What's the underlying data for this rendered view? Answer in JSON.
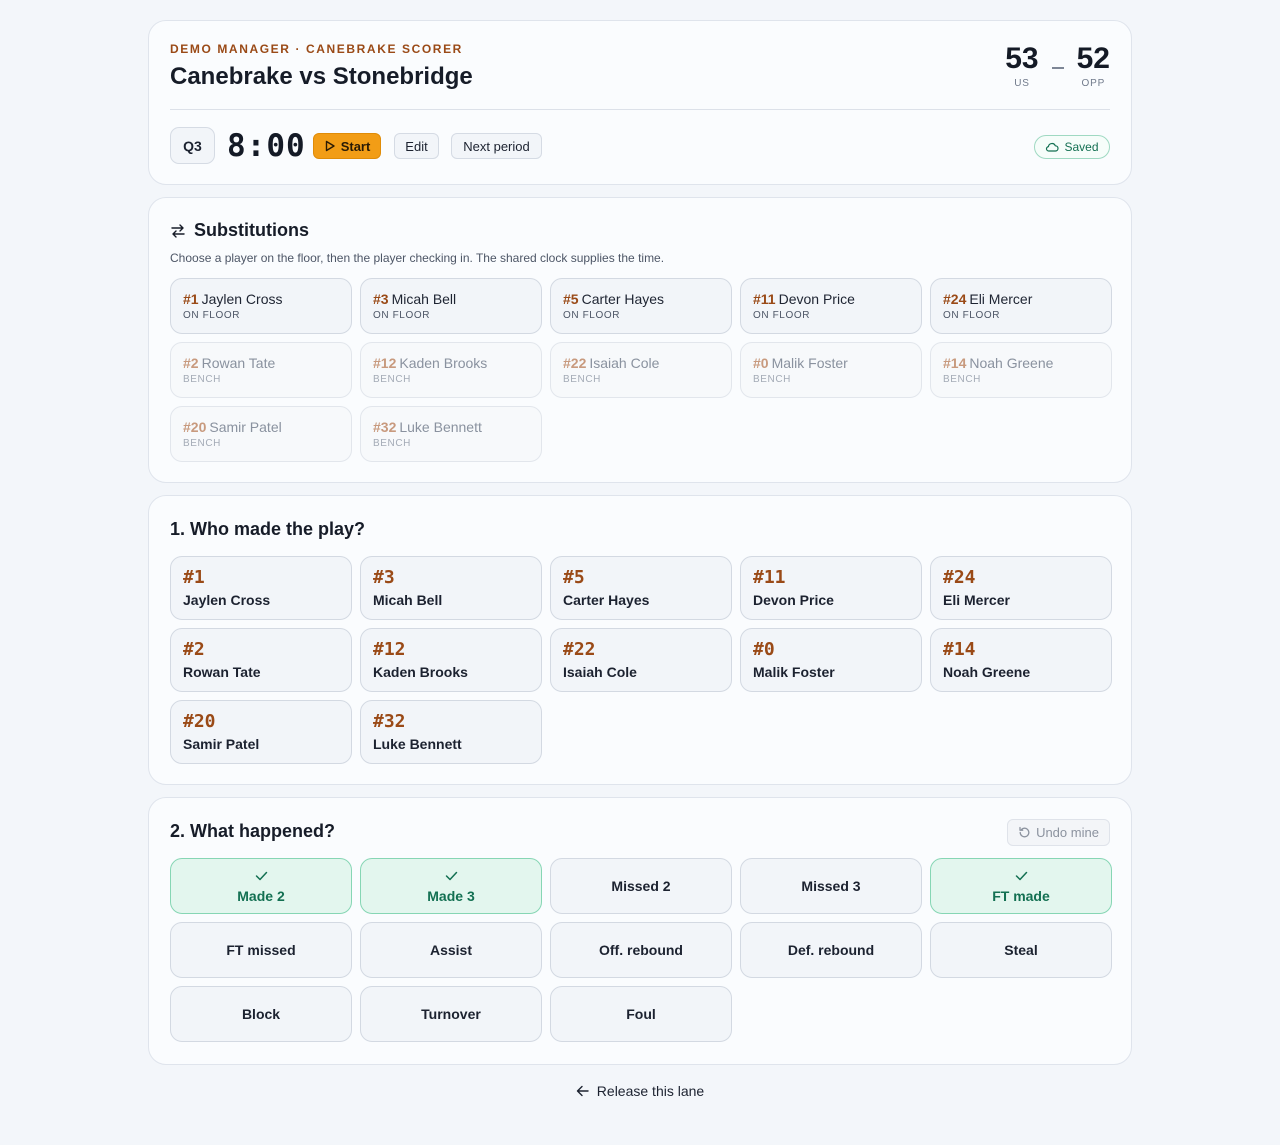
{
  "header": {
    "eyebrow": "Demo Manager · Canebrake Scorer",
    "title": "Canebrake vs Stonebridge",
    "score": {
      "us": "53",
      "us_label": "US",
      "opp": "52",
      "opp_label": "OPP"
    },
    "period": "Q3",
    "clock": "8:00",
    "start_label": "Start",
    "edit_label": "Edit",
    "next_period_label": "Next period",
    "saved_label": "Saved"
  },
  "substitutions": {
    "title": "Substitutions",
    "subtitle": "Choose a player on the floor, then the player checking in. The shared clock supplies the time.",
    "players": [
      {
        "number": "#1",
        "name": "Jaylen Cross",
        "status": "ON FLOOR"
      },
      {
        "number": "#3",
        "name": "Micah Bell",
        "status": "ON FLOOR"
      },
      {
        "number": "#5",
        "name": "Carter Hayes",
        "status": "ON FLOOR"
      },
      {
        "number": "#11",
        "name": "Devon Price",
        "status": "ON FLOOR"
      },
      {
        "number": "#24",
        "name": "Eli Mercer",
        "status": "ON FLOOR"
      },
      {
        "number": "#2",
        "name": "Rowan Tate",
        "status": "BENCH"
      },
      {
        "number": "#12",
        "name": "Kaden Brooks",
        "status": "BENCH"
      },
      {
        "number": "#22",
        "name": "Isaiah Cole",
        "status": "BENCH"
      },
      {
        "number": "#0",
        "name": "Malik Foster",
        "status": "BENCH"
      },
      {
        "number": "#14",
        "name": "Noah Greene",
        "status": "BENCH"
      },
      {
        "number": "#20",
        "name": "Samir Patel",
        "status": "BENCH"
      },
      {
        "number": "#32",
        "name": "Luke Bennett",
        "status": "BENCH"
      }
    ]
  },
  "who": {
    "title": "1. Who made the play?",
    "players": [
      {
        "number": "#1",
        "name": "Jaylen Cross"
      },
      {
        "number": "#3",
        "name": "Micah Bell"
      },
      {
        "number": "#5",
        "name": "Carter Hayes"
      },
      {
        "number": "#11",
        "name": "Devon Price"
      },
      {
        "number": "#24",
        "name": "Eli Mercer"
      },
      {
        "number": "#2",
        "name": "Rowan Tate"
      },
      {
        "number": "#12",
        "name": "Kaden Brooks"
      },
      {
        "number": "#22",
        "name": "Isaiah Cole"
      },
      {
        "number": "#0",
        "name": "Malik Foster"
      },
      {
        "number": "#14",
        "name": "Noah Greene"
      },
      {
        "number": "#20",
        "name": "Samir Patel"
      },
      {
        "number": "#32",
        "name": "Luke Bennett"
      }
    ]
  },
  "what": {
    "title": "2. What happened?",
    "undo_label": "Undo mine",
    "events": [
      {
        "label": "Made 2",
        "checked": true
      },
      {
        "label": "Made 3",
        "checked": true
      },
      {
        "label": "Missed 2",
        "checked": false
      },
      {
        "label": "Missed 3",
        "checked": false
      },
      {
        "label": "FT made",
        "checked": true
      },
      {
        "label": "FT missed",
        "checked": false
      },
      {
        "label": "Assist",
        "checked": false
      },
      {
        "label": "Off. rebound",
        "checked": false
      },
      {
        "label": "Def. rebound",
        "checked": false
      },
      {
        "label": "Steal",
        "checked": false
      },
      {
        "label": "Block",
        "checked": false
      },
      {
        "label": "Turnover",
        "checked": false
      },
      {
        "label": "Foul",
        "checked": false
      }
    ]
  },
  "footer": {
    "release_label": "Release this lane"
  },
  "colors": {
    "accent": "#f29d16",
    "jersey_number": "#9a4a17",
    "success": "#137052",
    "success_bg": "#e3f6ee"
  },
  "icons": {
    "start": "play-icon",
    "saved": "cloud-icon",
    "substitutions": "swap-icon",
    "undo": "undo-icon",
    "checked": "check-icon",
    "release": "arrow-left-icon"
  }
}
